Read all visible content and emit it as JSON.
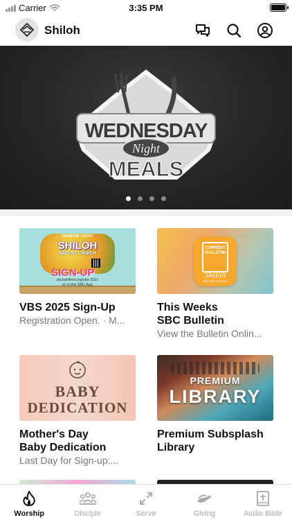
{
  "status": {
    "carrier": "Carrier",
    "time": "3:35 PM"
  },
  "header": {
    "title": "Shiloh"
  },
  "hero": {
    "line1": "WEDNESDAY",
    "line2": "Night",
    "line3": "MEALS",
    "slides": 4,
    "active_slide": 1
  },
  "cards": [
    {
      "title": "VBS 2025 Sign-Up",
      "subtitle": "Registration Open. · M...",
      "img": {
        "l1": "REGISTER TODAY!",
        "l2": "SHILOH",
        "l3": "BAPTIST CHURCH",
        "l4": "SIGN-UP",
        "l5": "sbchartford.org/vbs-2021",
        "l6": "or in the SBC App"
      }
    },
    {
      "title": "This Weeks\nSBC Bulletin",
      "subtitle": "View the Bulletin Onlin...",
      "img": {
        "l1": "CURRENT",
        "l2": "BULLETIN",
        "l3": "Shiloh",
        "l4": "BAPTIST CHURCH"
      }
    },
    {
      "title": "Mother's Day\nBaby Dedication",
      "subtitle": "Last Day for Sign-up:...",
      "img": {
        "l1": "BABY",
        "l2": "DEDICATION"
      }
    },
    {
      "title": "Premium Subsplash\nLibrary",
      "subtitle": "",
      "img": {
        "l1": "PREMIUM",
        "l2": "LIBRARY"
      }
    }
  ],
  "tabs": [
    {
      "label": "Worship",
      "icon": "flame-icon",
      "active": true
    },
    {
      "label": "Disciple",
      "icon": "group-icon"
    },
    {
      "label": "Serve",
      "icon": "arrows-icon"
    },
    {
      "label": "Giving",
      "icon": "hands-icon"
    },
    {
      "label": "Audio Bible",
      "icon": "bible-icon"
    }
  ]
}
